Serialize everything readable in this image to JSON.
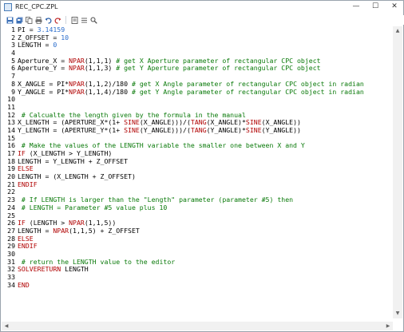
{
  "window": {
    "title": "REC_CPC.ZPL",
    "minimize_label": "—",
    "maximize_label": "☐",
    "close_label": "✕"
  },
  "toolbar": {
    "icons": [
      "save-icon",
      "save-all-icon",
      "copy-icon",
      "print-icon",
      "undo-icon",
      "redo-icon",
      "column-icon",
      "list-icon",
      "search-icon"
    ]
  },
  "colors": {
    "keyword": "#b00000",
    "number": "#2b6dcc",
    "comment": "#0a7a0a",
    "text": "#000000"
  },
  "scrollbar": {
    "up": "▲",
    "down": "▼",
    "left": "◀",
    "right": "▶"
  },
  "lines": [
    {
      "n": "1",
      "segs": [
        [
          "t",
          "PI = "
        ],
        [
          "num",
          "3.14159"
        ]
      ]
    },
    {
      "n": "2",
      "segs": [
        [
          "t",
          "Z_OFFSET = "
        ],
        [
          "num",
          "10"
        ]
      ]
    },
    {
      "n": "3",
      "segs": [
        [
          "t",
          "LENGTH = "
        ],
        [
          "num",
          "0"
        ]
      ]
    },
    {
      "n": "4",
      "segs": []
    },
    {
      "n": "5",
      "segs": [
        [
          "t",
          "Aperture_X = "
        ],
        [
          "kw",
          "NPAR"
        ],
        [
          "t",
          "(1,1,1) "
        ],
        [
          "cmt",
          "# get X Aperture parameter of rectangular CPC object"
        ]
      ]
    },
    {
      "n": "6",
      "segs": [
        [
          "t",
          "Aperture_Y = "
        ],
        [
          "kw",
          "NPAR"
        ],
        [
          "t",
          "(1,1,3) "
        ],
        [
          "cmt",
          "# get Y Aperture parameter of rectangular CPC object"
        ]
      ]
    },
    {
      "n": "7",
      "segs": []
    },
    {
      "n": "8",
      "segs": [
        [
          "t",
          "X_ANGLE = PI*"
        ],
        [
          "kw",
          "NPAR"
        ],
        [
          "t",
          "(1,1,2)/180 "
        ],
        [
          "cmt",
          "# get X Angle parameter of rectangular CPC object in radian"
        ]
      ]
    },
    {
      "n": "9",
      "segs": [
        [
          "t",
          "Y_ANGLE = PI*"
        ],
        [
          "kw",
          "NPAR"
        ],
        [
          "t",
          "(1,1,4)/180 "
        ],
        [
          "cmt",
          "# get Y Angle parameter of rectangular CPC object in radian"
        ]
      ]
    },
    {
      "n": "10",
      "segs": []
    },
    {
      "n": "11",
      "segs": []
    },
    {
      "n": "12",
      "segs": [
        [
          "cmt",
          " # Calcualte the length given by the formula in the manual"
        ]
      ]
    },
    {
      "n": "13",
      "segs": [
        [
          "t",
          "X_LENGTH = (APERTURE_X*(1+ "
        ],
        [
          "kw",
          "SINE"
        ],
        [
          "t",
          "(X_ANGLE)))/("
        ],
        [
          "kw",
          "TANG"
        ],
        [
          "t",
          "(X_ANGLE)*"
        ],
        [
          "kw",
          "SINE"
        ],
        [
          "t",
          "(X_ANGLE))"
        ]
      ]
    },
    {
      "n": "14",
      "segs": [
        [
          "t",
          "Y_LENGTH = (APERTURE_Y*(1+ "
        ],
        [
          "kw",
          "SINE"
        ],
        [
          "t",
          "(Y_ANGLE)))/("
        ],
        [
          "kw",
          "TANG"
        ],
        [
          "t",
          "(Y_ANGLE)*"
        ],
        [
          "kw",
          "SINE"
        ],
        [
          "t",
          "(Y_ANGLE))"
        ]
      ]
    },
    {
      "n": "15",
      "segs": []
    },
    {
      "n": "16",
      "segs": [
        [
          "cmt",
          " # Make the values of the LENGTH variable the smaller one between X and Y"
        ]
      ]
    },
    {
      "n": "17",
      "segs": [
        [
          "kw",
          "IF"
        ],
        [
          "t",
          " (X_LENGTH > Y_LENGTH)"
        ]
      ]
    },
    {
      "n": "18",
      "segs": [
        [
          "t",
          "LENGTH = Y_LENGTH + Z_OFFSET"
        ]
      ]
    },
    {
      "n": "19",
      "segs": [
        [
          "kw",
          "ELSE"
        ]
      ]
    },
    {
      "n": "20",
      "segs": [
        [
          "t",
          "LENGTH = (X_LENGTH + Z_OFFSET)"
        ]
      ]
    },
    {
      "n": "21",
      "segs": [
        [
          "kw",
          "ENDIF"
        ]
      ]
    },
    {
      "n": "22",
      "segs": []
    },
    {
      "n": "23",
      "segs": [
        [
          "cmt",
          " # If LENGTH is larger than the \"Length\" parameter (parameter #5) then"
        ]
      ]
    },
    {
      "n": "24",
      "segs": [
        [
          "cmt",
          " # LENGTH = Parameter #5 value plus 10"
        ]
      ]
    },
    {
      "n": "25",
      "segs": []
    },
    {
      "n": "26",
      "segs": [
        [
          "kw",
          "IF"
        ],
        [
          "t",
          " (LENGTH > "
        ],
        [
          "kw",
          "NPAR"
        ],
        [
          "t",
          "(1,1,5))"
        ]
      ]
    },
    {
      "n": "27",
      "segs": [
        [
          "t",
          "LENGTH = "
        ],
        [
          "kw",
          "NPAR"
        ],
        [
          "t",
          "(1,1,5) + Z_OFFSET"
        ]
      ]
    },
    {
      "n": "28",
      "segs": [
        [
          "kw",
          "ELSE"
        ]
      ]
    },
    {
      "n": "29",
      "segs": [
        [
          "kw",
          "ENDIF"
        ]
      ]
    },
    {
      "n": "30",
      "segs": []
    },
    {
      "n": "31",
      "segs": [
        [
          "cmt",
          " # return the LENGTH value to the editor"
        ]
      ]
    },
    {
      "n": "32",
      "segs": [
        [
          "kw",
          "SOLVERETURN"
        ],
        [
          "t",
          " LENGTH"
        ]
      ]
    },
    {
      "n": "33",
      "segs": []
    },
    {
      "n": "34",
      "segs": [
        [
          "kw",
          "END"
        ]
      ]
    }
  ]
}
